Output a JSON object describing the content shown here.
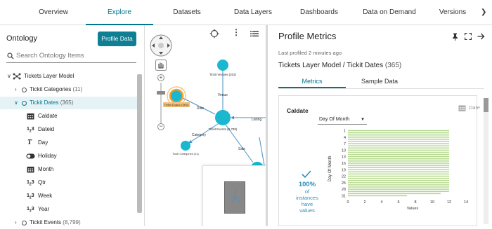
{
  "nav": {
    "tabs": [
      {
        "label": "Overview"
      },
      {
        "label": "Explore"
      },
      {
        "label": "Datasets"
      },
      {
        "label": "Data Layers"
      },
      {
        "label": "Dashboards"
      },
      {
        "label": "Data on Demand"
      },
      {
        "label": "Versions"
      }
    ],
    "active": "Explore"
  },
  "ontology": {
    "title": "Ontology",
    "profile_button": "Profile Data",
    "search_placeholder": "Search Ontology Items",
    "root": {
      "label": "Tickets Layer Model"
    },
    "groups": [
      {
        "label": "Tickit Categories",
        "count": "(11)"
      },
      {
        "label": "Tickit Dates",
        "count": "(365)"
      },
      {
        "label": "Tickit Events",
        "count": "(8,799)"
      }
    ],
    "fields": [
      {
        "label": "Caldate",
        "type": "date"
      },
      {
        "label": "Dateid",
        "type": "number"
      },
      {
        "label": "Day",
        "type": "text"
      },
      {
        "label": "Holiday",
        "type": "boolean"
      },
      {
        "label": "Month",
        "type": "date"
      },
      {
        "label": "Qtr",
        "type": "number"
      },
      {
        "label": "Week",
        "type": "number"
      },
      {
        "label": "Year",
        "type": "number"
      }
    ]
  },
  "graph": {
    "nodes": [
      {
        "label": "Tickit Venues (202)"
      },
      {
        "label": "Tickit Dates (365)"
      },
      {
        "label": "Tickit Events (8,799)"
      },
      {
        "label": "Tickit Categories (11)"
      }
    ],
    "edges": [
      {
        "label": "Venue"
      },
      {
        "label": "Date"
      },
      {
        "label": "Listing"
      },
      {
        "label": "Category"
      },
      {
        "label": "Sale"
      }
    ]
  },
  "profile": {
    "title": "Profile Metrics",
    "last_profiled": "Last profiled 2 minutes ago",
    "path_main": "Tickets Layer Model / Tickit Dates",
    "path_count": "(365)",
    "tabs": [
      {
        "label": "Metrics"
      },
      {
        "label": "Sample Data"
      }
    ],
    "active_tab": "Metrics",
    "card": {
      "field": "Caldate",
      "type_label": "Date",
      "dropdown": "Day Of Month",
      "percent": "100%",
      "percent_caption": [
        "of",
        "instances",
        "have",
        "values"
      ]
    }
  },
  "chart_data": {
    "type": "bar",
    "orientation": "horizontal",
    "ylabel": "Day Of Month",
    "xlabel": "Values",
    "categories": [
      "1",
      "2",
      "3",
      "4",
      "5",
      "6",
      "7",
      "8",
      "9",
      "10",
      "11",
      "12",
      "13",
      "14",
      "15",
      "16",
      "17",
      "18",
      "19",
      "20",
      "21",
      "22",
      "23",
      "24",
      "25",
      "26",
      "27",
      "28",
      "29",
      "30",
      "31"
    ],
    "values": [
      12,
      12,
      12,
      12,
      12,
      12,
      12,
      12,
      12,
      12,
      12,
      12,
      12,
      12,
      12,
      12,
      12,
      12,
      12,
      12,
      12,
      12,
      12,
      12,
      12,
      12,
      12,
      12,
      12,
      11,
      7
    ],
    "y_ticks": [
      "1",
      "4",
      "7",
      "10",
      "13",
      "16",
      "19",
      "22",
      "25",
      "28",
      "31"
    ],
    "x_ticks": [
      "0",
      "2",
      "4",
      "6",
      "8",
      "10",
      "12",
      "14"
    ],
    "xlim": [
      0,
      14
    ],
    "bar_color": "#b6d98f"
  },
  "colors": {
    "accent": "#00758f",
    "node": "#1bb7cf",
    "node_selected": "#f0a030"
  }
}
